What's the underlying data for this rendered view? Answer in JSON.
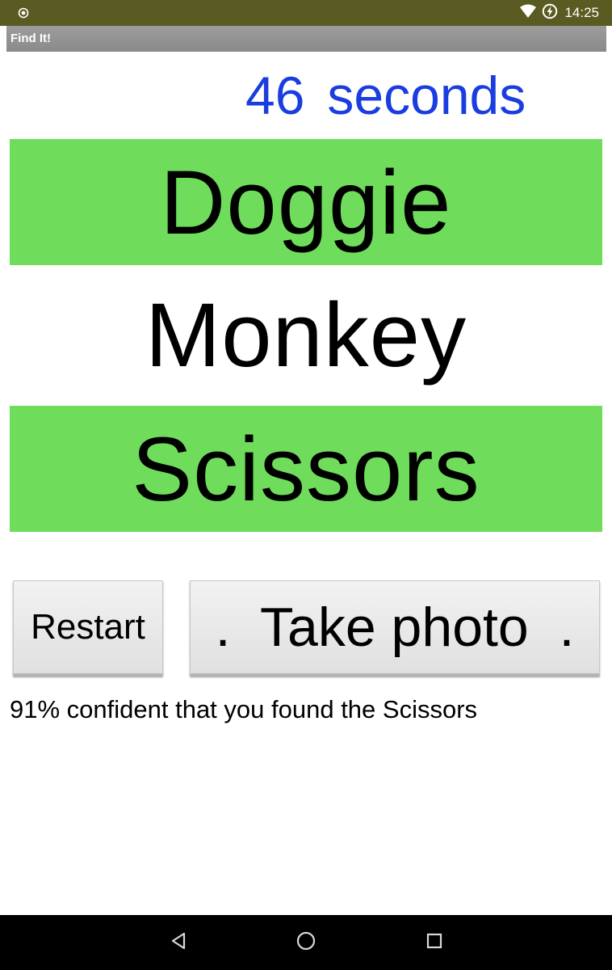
{
  "status_bar": {
    "time": "14:25",
    "icons": [
      "location-icon",
      "wifi-icon",
      "battery-charging-icon"
    ]
  },
  "app": {
    "title": "Find It!"
  },
  "timer": {
    "value": "46",
    "unit": "seconds",
    "color": "#1a3de0"
  },
  "words": [
    {
      "label": "Doggie",
      "found": true
    },
    {
      "label": "Monkey",
      "found": false
    },
    {
      "label": "Scissors",
      "found": true
    }
  ],
  "found_color": "#6fdd5b",
  "buttons": {
    "restart_label": "Restart",
    "take_photo_label": ".  Take photo  ."
  },
  "result_text": "91% confident that you found the Scissors",
  "nav": {
    "icons": [
      "back-icon",
      "home-icon",
      "recent-apps-icon"
    ]
  }
}
